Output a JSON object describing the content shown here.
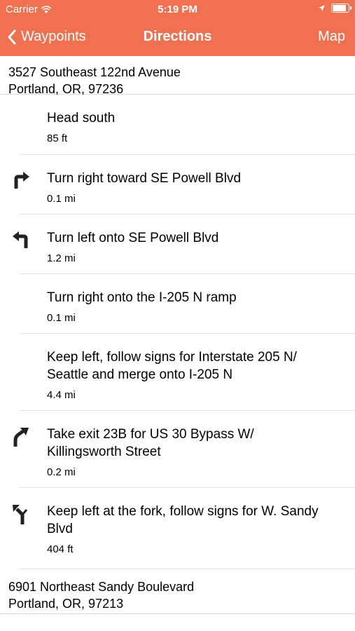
{
  "status_bar": {
    "carrier": "Carrier",
    "time": "5:19 PM"
  },
  "nav": {
    "back_label": "Waypoints",
    "title": "Directions",
    "map_label": "Map"
  },
  "start": {
    "line1": "3527 Southeast 122nd Avenue",
    "line2": "Portland, OR, 97236"
  },
  "steps": [
    {
      "text": "Head south",
      "distance": "85 ft",
      "icon": "none"
    },
    {
      "text": "Turn right toward SE Powell Blvd",
      "distance": "0.1 mi",
      "icon": "turn-right-icon"
    },
    {
      "text": "Turn left onto SE Powell Blvd",
      "distance": "1.2 mi",
      "icon": "turn-left-icon"
    },
    {
      "text": "Turn right onto the I-205 N ramp",
      "distance": "0.1 mi",
      "icon": "none"
    },
    {
      "text": "Keep left, follow signs for Interstate 205 N/ Seattle and merge onto I-205 N",
      "distance": "4.4 mi",
      "icon": "none"
    },
    {
      "text": "Take exit 23B for US 30 Bypass W/ Killingsworth Street",
      "distance": "0.2 mi",
      "icon": "slight-right-icon"
    },
    {
      "text": "Keep left at the fork, follow signs for W. Sandy Blvd",
      "distance": "404 ft",
      "icon": "fork-left-icon"
    }
  ],
  "end": {
    "line1": "6901 Northeast Sandy Boulevard",
    "line2": "Portland, OR, 97213"
  },
  "colors": {
    "accent": "#f0714f",
    "separator": "#e3e3e3"
  }
}
